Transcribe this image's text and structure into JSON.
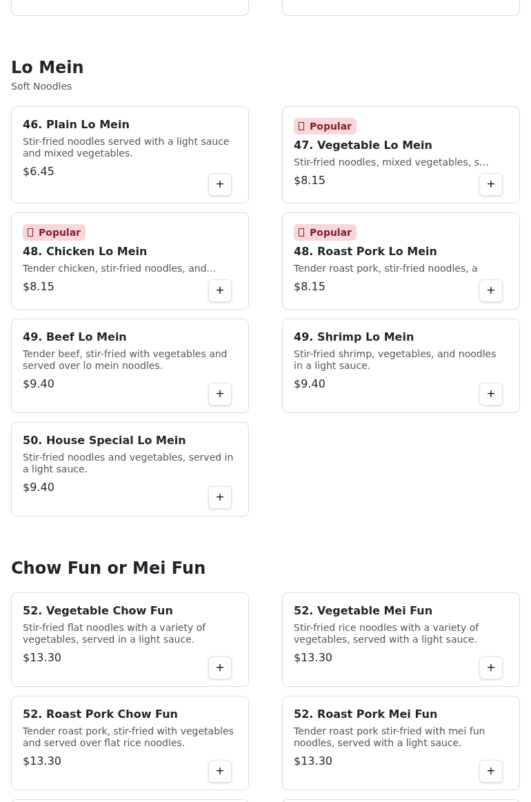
{
  "sections": [
    {
      "title": "Lo Mein",
      "subtitle": "Soft Noodles",
      "items": [
        {
          "name": "46. Plain Lo Mein",
          "description": "Stir-fried noodles served with a light sauce and mixed vegetables.",
          "price": "$6.45",
          "popular": false
        },
        {
          "name": "47. Vegetable Lo Mein",
          "description": "Stir-fried noodles, mixed vegetables, s…",
          "price": "$8.15",
          "popular": true,
          "badge": "Popular"
        },
        {
          "name": "48. Chicken Lo Mein",
          "description": "Tender chicken, stir-fried noodles, and…",
          "price": "$8.15",
          "popular": true,
          "badge": "Popular"
        },
        {
          "name": "48. Roast Pork Lo Mein",
          "description": "Tender roast pork, stir-fried noodles, a",
          "price": "$8.15",
          "popular": true,
          "badge": "Popular"
        },
        {
          "name": "49. Beef Lo Mein",
          "description": "Tender beef, stir-fried with vegetables and served over lo mein noodles.",
          "price": "$9.40",
          "popular": false
        },
        {
          "name": "49. Shrimp Lo Mein",
          "description": "Stir-fried shrimp, vegetables, and noodles in a light sauce.",
          "price": "$9.40",
          "popular": false
        },
        {
          "name": "50. House Special Lo Mein",
          "description": "Stir-fried noodles and vegetables, served in a light sauce.",
          "price": "$9.40",
          "popular": false
        }
      ]
    },
    {
      "title": "Chow Fun or Mei Fun",
      "items": [
        {
          "name": "52. Vegetable Chow Fun",
          "description": "Stir-fried flat noodles with a variety of vegetables, served in a light sauce.",
          "price": "$13.30",
          "popular": false
        },
        {
          "name": "52. Vegetable Mei Fun",
          "description": "Stir-fried rice noodles with a variety of vegetables, served with a light sauce.",
          "price": "$13.30",
          "popular": false
        },
        {
          "name": "52. Roast Pork Chow Fun",
          "description": "Tender roast pork, stir-fried with vegetables and served over flat rice noodles.",
          "price": "$13.30",
          "popular": false
        },
        {
          "name": "52. Roast Pork Mei Fun",
          "description": "Tender roast pork stir-fried with mei fun noodles, served with a light sauce.",
          "price": "$13.30",
          "popular": false
        }
      ]
    }
  ],
  "add_button_label": "+"
}
